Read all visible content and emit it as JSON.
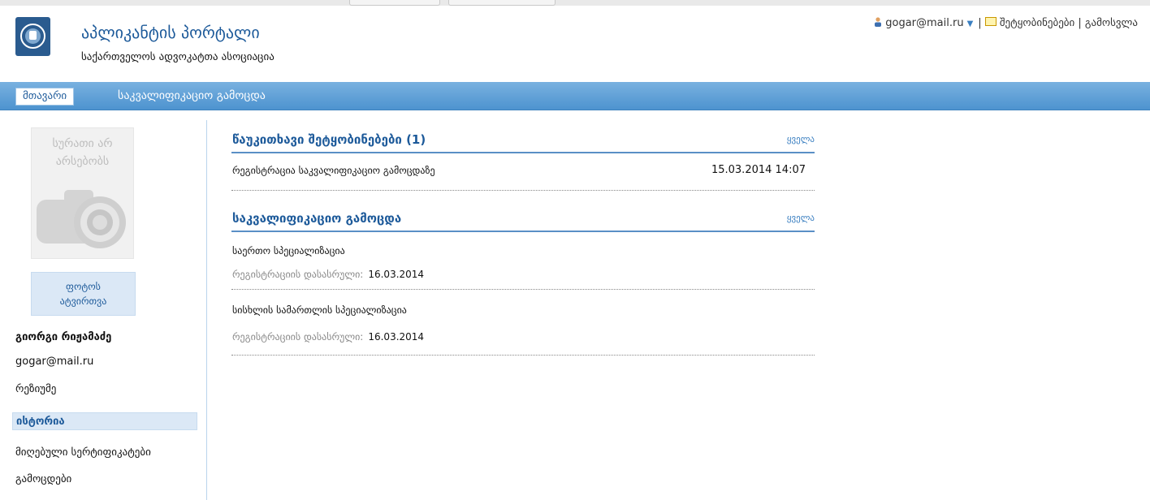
{
  "header": {
    "title": "აპლიკანტის პორტალი",
    "subtitle": "საქართველოს ადვოკატთა ასოციაცია",
    "user_email": "gogar@mail.ru",
    "notifications_label": "შეტყობინებები",
    "logout_label": "გამოსვლა",
    "separator": "|"
  },
  "nav": {
    "home_label": "მთავარი",
    "exam_label": "საკვალიფიკაციო გამოცდა"
  },
  "sidebar": {
    "no_photo_line1": "სურათი არ",
    "no_photo_line2": "არსებობს",
    "upload_line1": "ფოტოს",
    "upload_line2": "ატვირთვა",
    "user_name": "გიორგი რიჟამაძე",
    "email": "gogar@mail.ru",
    "resume_label": "რეზიუმე",
    "history_title": "ისტორია",
    "history_items": [
      "მიღებული სერტიფიკატები",
      "გამოცდები"
    ]
  },
  "unread": {
    "title": "წაუკითხავი შეტყობინებები (1)",
    "all_label": "ყველა",
    "items": [
      {
        "text": "რეგისტრაცია საკვალიფიკაციო გამოცდაზე",
        "date": "15.03.2014 14:07"
      }
    ]
  },
  "exams": {
    "title": "საკვალიფიკაციო გამოცდა",
    "all_label": "ყველა",
    "items": [
      {
        "name": "საერთო სპეციალიზაცია",
        "deadline_label": "რეგისტრაციის დასასრული:",
        "deadline": "16.03.2014"
      },
      {
        "name": "სისხლის სამართლის სპეციალიზაცია",
        "deadline_label": "რეგისტრაციის დასასრული:",
        "deadline": "16.03.2014"
      }
    ]
  },
  "colors": {
    "brand": "#1d5a9a",
    "navbar": "#5c9fd6",
    "panel": "#dbe8f6"
  }
}
